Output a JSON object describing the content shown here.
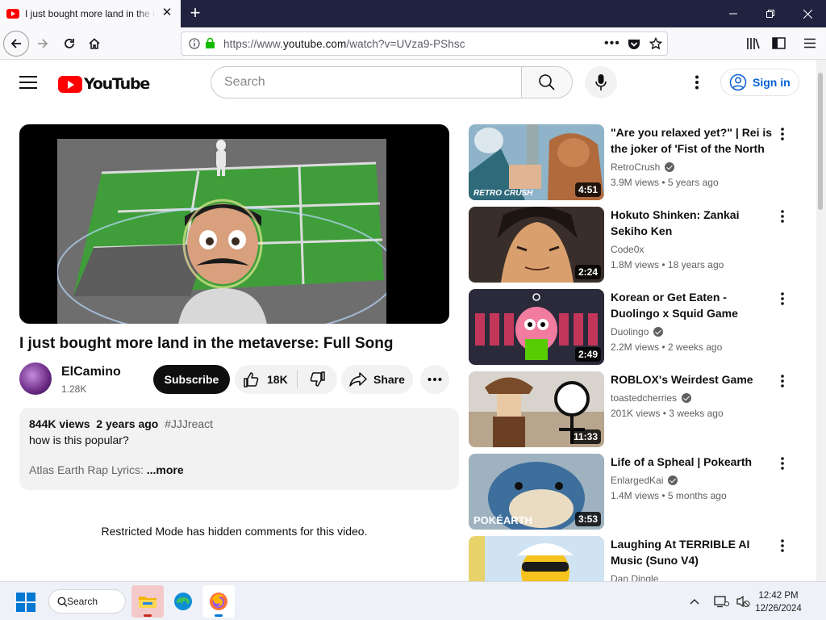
{
  "browser": {
    "tab_title": "I just bought more land in the metaverse: Full Song - YouTube",
    "url_prefix": "https://www.",
    "url_domain": "youtube.com",
    "url_path": "/watch?v=UVza9-PShsc"
  },
  "header": {
    "logo_text": "YouTube",
    "search_placeholder": "Search",
    "signin_label": "Sign in"
  },
  "video": {
    "title": "I just bought more land in the metaverse: Full Song",
    "channel": "ElCamino",
    "subscribers": "1.28K",
    "subscribe_label": "Subscribe",
    "likes": "18K",
    "share_label": "Share"
  },
  "description": {
    "views": "844K views",
    "age": "2 years ago",
    "hashtag": "#JJJreact",
    "line1": "how is this popular?",
    "line2": "Atlas Earth Rap Lyrics:",
    "more_label": "...more"
  },
  "comments_notice": "Restricted Mode has hidden comments for this video.",
  "recommendations": [
    {
      "title": "\"Are you relaxed yet?\" | Rei is the joker of 'Fist of the North",
      "channel": "RetroCrush",
      "verified": true,
      "views": "3.9M views",
      "age": "5 years ago",
      "duration": "4:51"
    },
    {
      "title": "Hokuto Shinken: Zankai Sekiho Ken",
      "channel": "Code0x",
      "verified": false,
      "views": "1.8M views",
      "age": "18 years ago",
      "duration": "2:24"
    },
    {
      "title": "Korean or Get Eaten - Duolingo x Squid Game",
      "channel": "Duolingo",
      "verified": true,
      "views": "2.2M views",
      "age": "2 weeks ago",
      "duration": "2:49"
    },
    {
      "title": "ROBLOX's Weirdest Game",
      "channel": "toastedcherries",
      "verified": true,
      "views": "201K views",
      "age": "3 weeks ago",
      "duration": "11:33"
    },
    {
      "title": "Life of a Spheal | Pokearth",
      "channel": "EnlargedKai",
      "verified": true,
      "views": "1.4M views",
      "age": "5 months ago",
      "duration": "3:53"
    },
    {
      "title": "Laughing At TERRIBLE AI Music (Suno V4)",
      "channel": "Dan Dingle",
      "verified": false,
      "views": "",
      "age": "",
      "duration": ""
    }
  ],
  "thumbnail_text": {
    "retrocrush": "RETRO CRUSH",
    "pokearth": "POKÉARTH"
  },
  "taskbar": {
    "search_label": "Search",
    "time": "12:42 PM",
    "date": "12/26/2024"
  }
}
